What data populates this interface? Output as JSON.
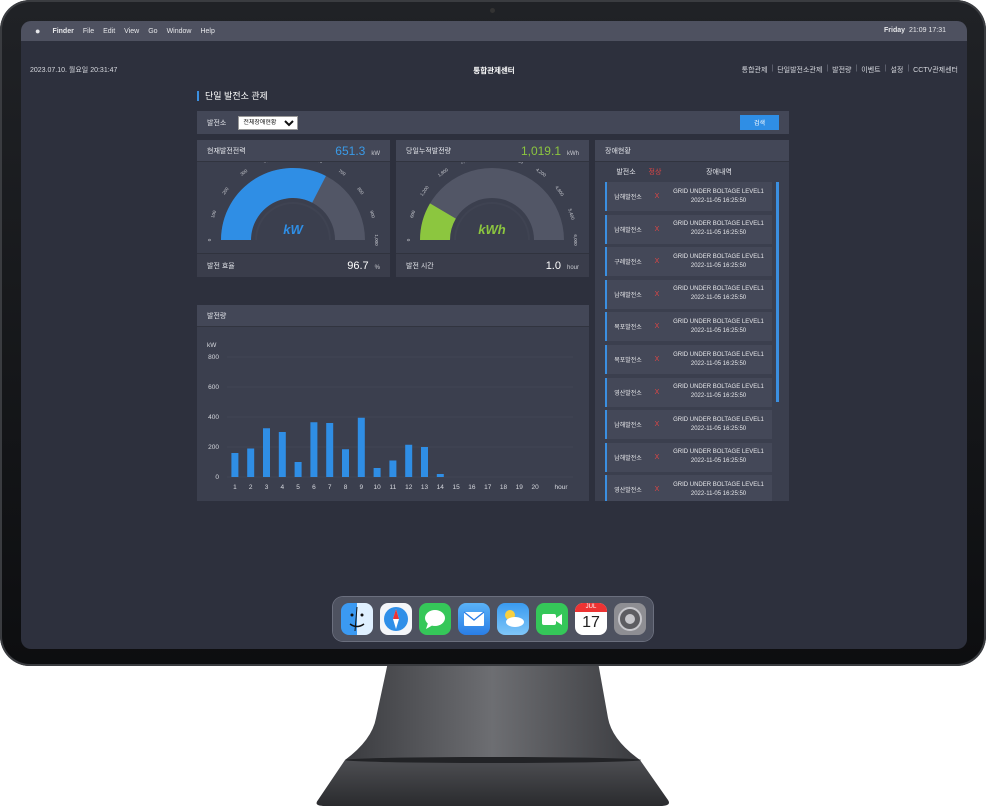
{
  "menubar": {
    "apple": "",
    "items": [
      "Finder",
      "File",
      "Edit",
      "View",
      "Go",
      "Window",
      "Help"
    ],
    "day": "Friday",
    "clock": "21:09  17:31"
  },
  "header": {
    "datetime": "2023.07.10. 월요일 20:31:47",
    "title": "통합관제센터",
    "nav": [
      "통합관제",
      "단일발전소관제",
      "발전량",
      "이벤트",
      "설정",
      "CCTV관제센터"
    ]
  },
  "page": {
    "title": "단일 발전소 관제",
    "filter_label": "발전소",
    "filter_selected": "전체장애현황",
    "search_label": "검색"
  },
  "gauge_power": {
    "title": "현재발전전력",
    "value": "651.3",
    "unit": "kW",
    "center_label": "kW",
    "foot_label": "발전 효율",
    "foot_value": "96.7",
    "foot_unit": "%",
    "ticks": [
      "0",
      "100",
      "200",
      "300",
      "400",
      "500",
      "600",
      "700",
      "800",
      "900",
      "1,000"
    ],
    "level_value": 651.3,
    "max": 1000,
    "color": "#2f8ee5"
  },
  "gauge_energy": {
    "title": "당일누적발전량",
    "value": "1,019.1",
    "unit": "kWh",
    "center_label": "kWh",
    "foot_label": "발전 시간",
    "foot_value": "1.0",
    "foot_unit": "hour",
    "ticks": [
      "0",
      "600",
      "1,200",
      "1,800",
      "2,400",
      "3,000",
      "3,600",
      "4,200",
      "4,800",
      "5,400",
      "6,000"
    ],
    "level_value": 1019.1,
    "max": 6000,
    "color": "#8cc63f"
  },
  "production": {
    "title": "발전량"
  },
  "chart_data": {
    "type": "bar",
    "title": "발전량",
    "ylabel": "kW",
    "xlabel": "hour",
    "ylim": [
      0,
      800
    ],
    "yticks": [
      "0",
      "200",
      "400",
      "600",
      "800"
    ],
    "categories": [
      "1",
      "2",
      "3",
      "4",
      "5",
      "6",
      "7",
      "8",
      "9",
      "10",
      "11",
      "12",
      "13",
      "14",
      "15",
      "16",
      "17",
      "18",
      "19",
      "20"
    ],
    "values": [
      160,
      190,
      325,
      300,
      100,
      365,
      360,
      185,
      395,
      60,
      110,
      215,
      200,
      20,
      0,
      0,
      0,
      0,
      0,
      0
    ],
    "grid": true,
    "color": "#2f8ee5"
  },
  "faults": {
    "title": "장애현황",
    "col_station": "발전소",
    "col_status": "정상",
    "col_detail": "장애내역",
    "rows": [
      {
        "station": "남해발전소",
        "status": "X",
        "detail": "GRID UNDER BOLTAGE LEVEL1",
        "time": "2022-11-05 16:25:50"
      },
      {
        "station": "남해발전소",
        "status": "X",
        "detail": "GRID UNDER BOLTAGE LEVEL1",
        "time": "2022-11-05 16:25:50"
      },
      {
        "station": "구례발전소",
        "status": "X",
        "detail": "GRID UNDER BOLTAGE LEVEL1",
        "time": "2022-11-05 16:25:50"
      },
      {
        "station": "남해발전소",
        "status": "X",
        "detail": "GRID UNDER BOLTAGE LEVEL1",
        "time": "2022-11-05 16:25:50"
      },
      {
        "station": "목포발전소",
        "status": "X",
        "detail": "GRID UNDER BOLTAGE LEVEL1",
        "time": "2022-11-05 16:25:50"
      },
      {
        "station": "목포발전소",
        "status": "X",
        "detail": "GRID UNDER BOLTAGE LEVEL1",
        "time": "2022-11-05 16:25:50"
      },
      {
        "station": "영산발전소",
        "status": "X",
        "detail": "GRID UNDER BOLTAGE LEVEL1",
        "time": "2022-11-05 16:25:50"
      },
      {
        "station": "남해발전소",
        "status": "X",
        "detail": "GRID UNDER BOLTAGE LEVEL1",
        "time": "2022-11-05 16:25:50"
      },
      {
        "station": "남해발전소",
        "status": "X",
        "detail": "GRID UNDER BOLTAGE LEVEL1",
        "time": "2022-11-05 16:25:50"
      },
      {
        "station": "영산발전소",
        "status": "X",
        "detail": "GRID UNDER BOLTAGE LEVEL1",
        "time": "2022-11-05 16:25:50"
      }
    ]
  },
  "dock": {
    "apps": [
      "finder-icon",
      "safari-icon",
      "messages-icon",
      "mail-icon",
      "weather-icon",
      "facetime-icon",
      "calendar-icon",
      "settings-icon"
    ],
    "calendar_month": "JUL",
    "calendar_day": "17"
  }
}
